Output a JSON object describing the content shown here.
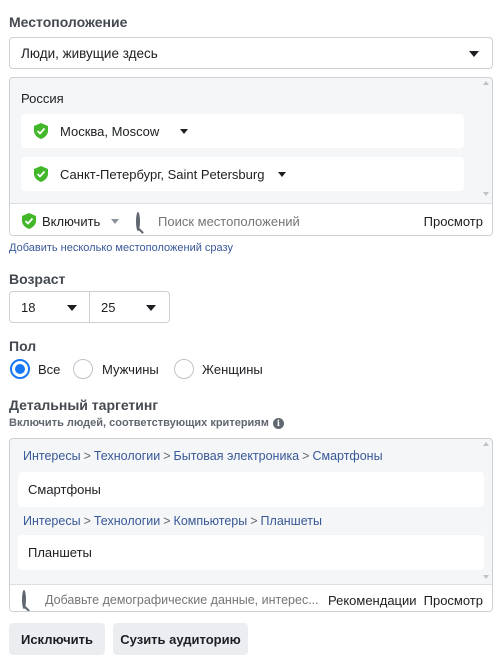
{
  "location": {
    "title": "Местоположение",
    "audience_select": "Люди, живущие здесь",
    "country": "Россия",
    "items": [
      {
        "label": "Москва, Moscow"
      },
      {
        "label": "Санкт-Петербург, Saint Petersburg"
      }
    ],
    "include_label": "Включить",
    "search_placeholder": "Поиск местоположений",
    "browse_label": "Просмотр",
    "bulk_link": "Добавить несколько местоположений сразу"
  },
  "age": {
    "title": "Возраст",
    "min": "18",
    "max": "25"
  },
  "gender": {
    "title": "Пол",
    "options": [
      "Все",
      "Мужчины",
      "Женщины"
    ],
    "selected": "Все"
  },
  "targeting": {
    "title": "Детальный таргетинг",
    "subtitle": "Включить людей, соответствующих критериям",
    "groups": [
      {
        "path": [
          "Интересы",
          "Технологии",
          "Бытовая электроника",
          "Смартфоны"
        ],
        "value": "Смартфоны"
      },
      {
        "path": [
          "Интересы",
          "Технологии",
          "Компьютеры",
          "Планшеты"
        ],
        "value": "Планшеты"
      }
    ],
    "search_placeholder": "Добавьте демографические данные, интерес...",
    "suggestions_label": "Рекомендации",
    "browse_label": "Просмотр"
  },
  "actions": {
    "exclude_label": "Исключить",
    "narrow_label": "Сузить аудиторию"
  },
  "colors": {
    "accent": "#1877f2",
    "link": "#385898",
    "pin_green": "#42b72a"
  },
  "icons": [
    "location-pin-icon",
    "dropdown-caret-icon",
    "search-icon",
    "info-icon"
  ]
}
